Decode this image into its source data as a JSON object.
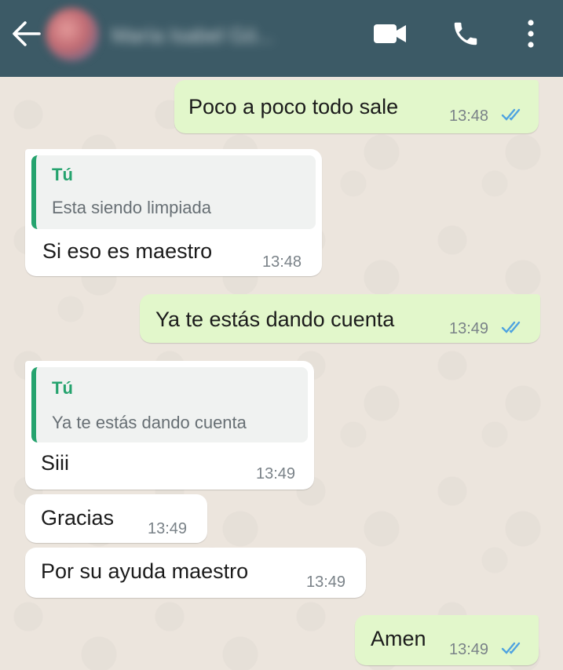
{
  "header": {
    "contact_name": "María Isabel Gó...",
    "icons": [
      "back-arrow-icon",
      "avatar",
      "video-call-icon",
      "voice-call-icon",
      "more-options-icon"
    ],
    "background_color": "#3c5a66"
  },
  "colors": {
    "outgoing_bubble": "#e2f7cb",
    "incoming_bubble": "#ffffff",
    "quote_accent": "#25a36e",
    "read_ticks": "#4fa3e0",
    "chat_background": "#ece5dd"
  },
  "messages": [
    {
      "direction": "outgoing",
      "text": "Poco a poco todo sale",
      "time": "13:48",
      "status": "read"
    },
    {
      "direction": "incoming",
      "quote": {
        "author": "Tú",
        "text": "Esta siendo limpiada"
      },
      "text": "Si eso es maestro",
      "time": "13:48"
    },
    {
      "direction": "outgoing",
      "text": "Ya te estás dando cuenta",
      "time": "13:49",
      "status": "read"
    },
    {
      "direction": "incoming",
      "quote": {
        "author": "Tú",
        "text": "Ya te estás dando cuenta"
      },
      "text": "Siii",
      "time": "13:49"
    },
    {
      "direction": "incoming",
      "text": "Gracias",
      "time": "13:49"
    },
    {
      "direction": "incoming",
      "text": "Por su ayuda maestro",
      "time": "13:49"
    },
    {
      "direction": "outgoing",
      "text": "Amen",
      "time": "13:49",
      "status": "read"
    }
  ]
}
